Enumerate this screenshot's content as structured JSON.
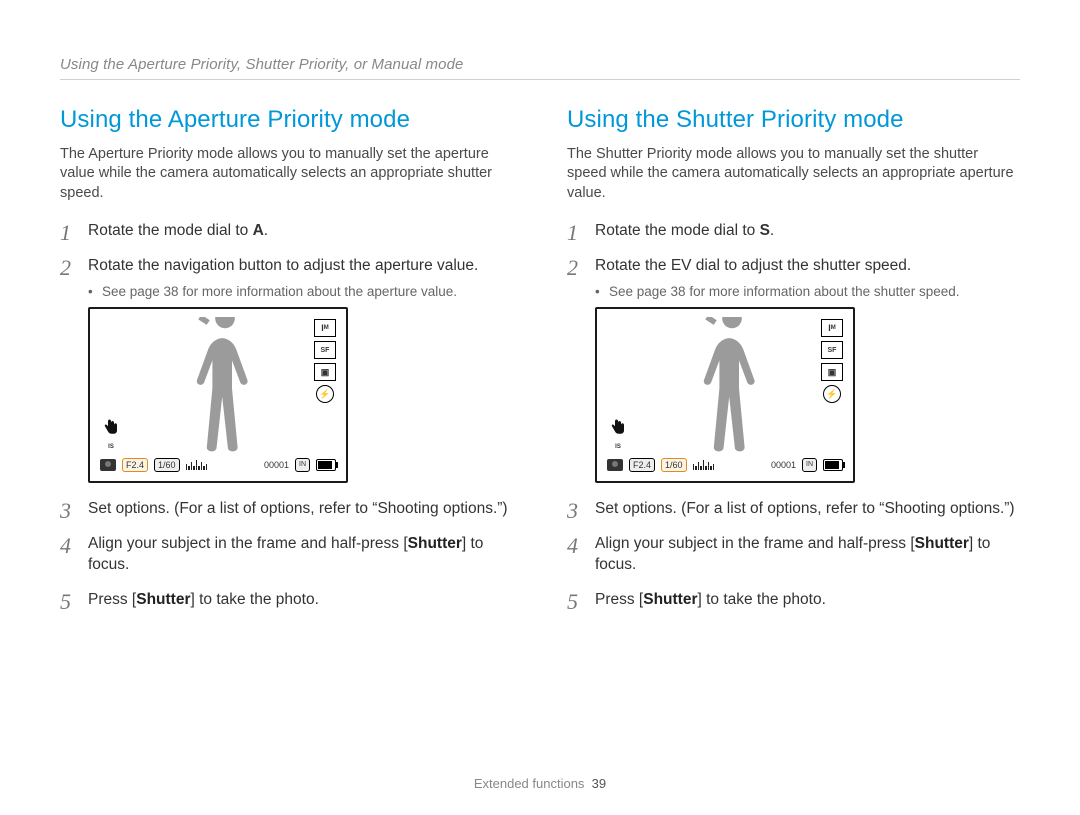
{
  "breadcrumb": "Using the Aperture Priority, Shutter Priority, or Manual mode",
  "left": {
    "heading": "Using the Aperture Priority mode",
    "intro": "The Aperture Priority mode allows you to manually set the aperture value while the camera automatically selects an appropriate shutter speed.",
    "step1_pre": "Rotate the mode dial to ",
    "step1_letter": "A",
    "step1_post": ".",
    "step2": "Rotate the navigation button to adjust the aperture value.",
    "step2_sub": "See page 38 for more information about the aperture value.",
    "step3": "Set options. (For a list of options, refer to “Shooting options.”)",
    "step4_pre": "Align your subject in the frame and half-press [",
    "step4_b": "Shutter",
    "step4_post": "] to focus.",
    "step5_pre": "Press [",
    "step5_b": "Shutter",
    "step5_post": "] to take the photo.",
    "lcd": {
      "f_value": "F2.4",
      "shutter": "1/60",
      "counter": "00001",
      "mem": "IN",
      "highlight": "aperture"
    }
  },
  "right": {
    "heading": "Using the Shutter Priority mode",
    "intro": "The Shutter Priority mode allows you to manually set the shutter speed while the camera automatically selects an appropriate aperture value.",
    "step1_pre": "Rotate the mode dial to ",
    "step1_letter": "S",
    "step1_post": ".",
    "step2": "Rotate the EV dial to adjust the shutter speed.",
    "step2_sub": "See page 38 for more information about the shutter speed.",
    "step3": "Set options. (For a list of options, refer to “Shooting options.”)",
    "step4_pre": "Align your subject in the frame and half-press [",
    "step4_b": "Shutter",
    "step4_post": "] to focus.",
    "step5_pre": "Press [",
    "step5_b": "Shutter",
    "step5_post": "] to take the photo.",
    "lcd": {
      "f_value": "F2.4",
      "shutter": "1/60",
      "counter": "00001",
      "mem": "IN",
      "highlight": "shutter"
    }
  },
  "footer_label": "Extended functions",
  "page_number": "39"
}
